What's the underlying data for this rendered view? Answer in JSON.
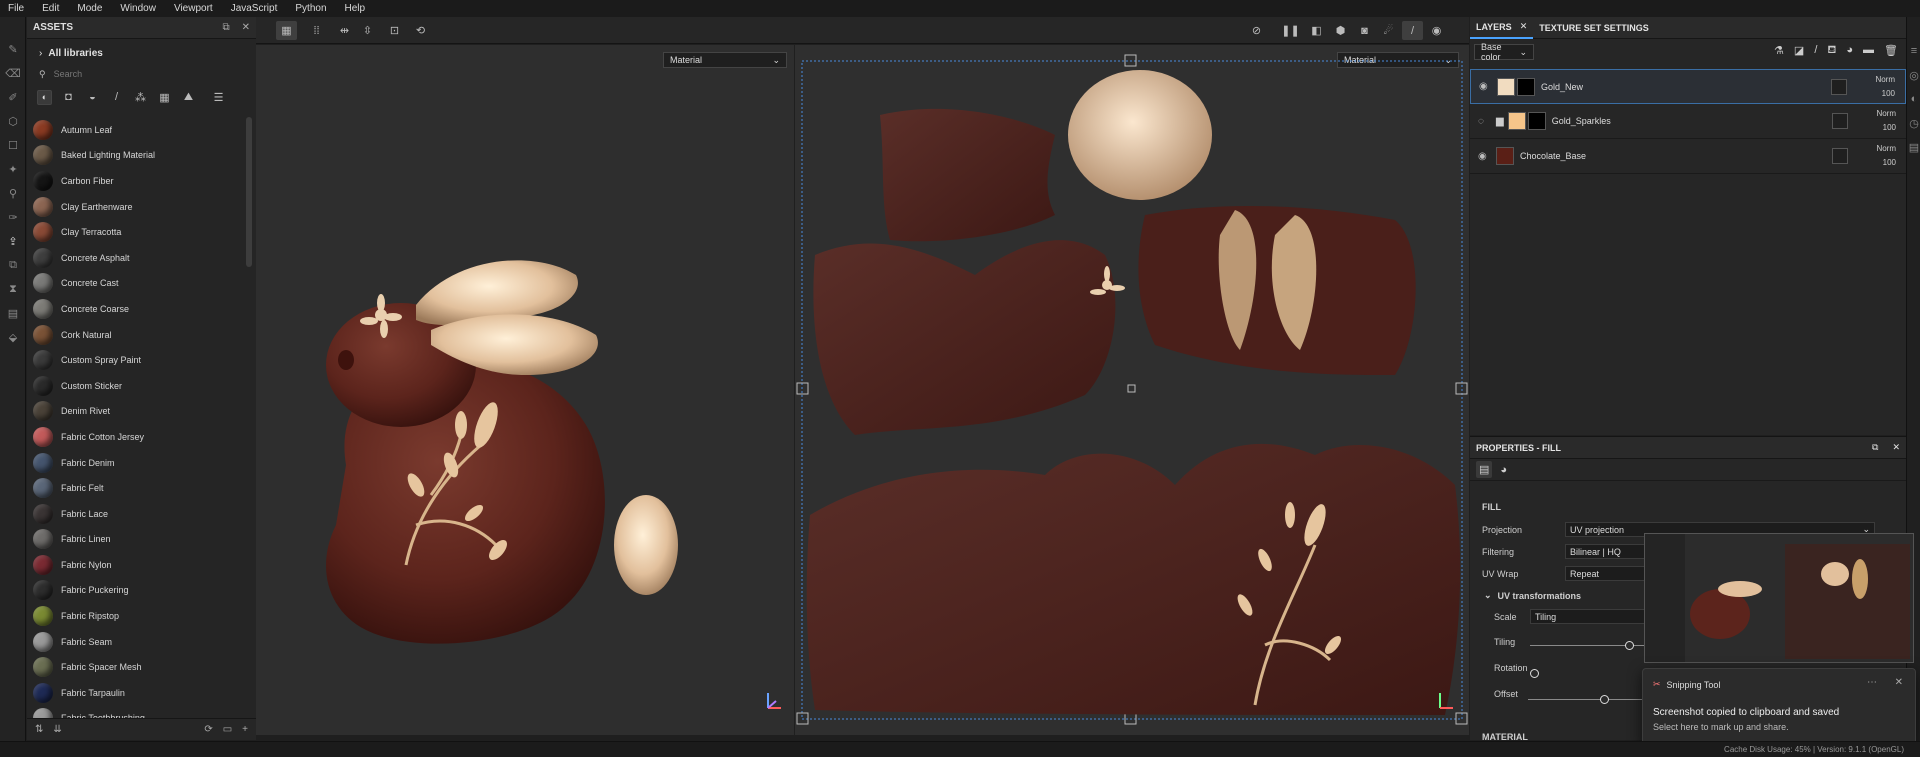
{
  "menu": [
    "File",
    "Edit",
    "Mode",
    "Window",
    "Viewport",
    "JavaScript",
    "Python",
    "Help"
  ],
  "assets": {
    "title": "ASSETS",
    "libraries": "All libraries",
    "search_placeholder": "Search",
    "materials": [
      {
        "name": "Autumn Leaf",
        "color": "#8a3a22"
      },
      {
        "name": "Baked Lighting Material",
        "color": "#6b5a48"
      },
      {
        "name": "Carbon Fiber",
        "color": "#151515"
      },
      {
        "name": "Clay Earthenware",
        "color": "#8c6552"
      },
      {
        "name": "Clay Terracotta",
        "color": "#8a4a36"
      },
      {
        "name": "Concrete Asphalt",
        "color": "#3e3e3e"
      },
      {
        "name": "Concrete Cast",
        "color": "#7a7a78"
      },
      {
        "name": "Concrete Coarse",
        "color": "#7c7b76"
      },
      {
        "name": "Cork Natural",
        "color": "#7a5236"
      },
      {
        "name": "Custom Spray Paint",
        "color": "#3a3a3a"
      },
      {
        "name": "Custom Sticker",
        "color": "#2a2a2a"
      },
      {
        "name": "Denim Rivet",
        "color": "#4a4238"
      },
      {
        "name": "Fabric Cotton Jersey",
        "color": "#c25a5a"
      },
      {
        "name": "Fabric Denim",
        "color": "#45556e"
      },
      {
        "name": "Fabric Felt",
        "color": "#5a6678"
      },
      {
        "name": "Fabric Lace",
        "color": "#3a3434"
      },
      {
        "name": "Fabric Linen",
        "color": "#6e6c6a"
      },
      {
        "name": "Fabric Nylon",
        "color": "#7a2a32"
      },
      {
        "name": "Fabric Puckering",
        "color": "#2d2d2d"
      },
      {
        "name": "Fabric Ripstop",
        "color": "#7a8a32"
      },
      {
        "name": "Fabric Seam",
        "color": "#9a9a9a"
      },
      {
        "name": "Fabric Spacer Mesh",
        "color": "#6a6e52"
      },
      {
        "name": "Fabric Tarpaulin",
        "color": "#1e2a55"
      },
      {
        "name": "Fabric Toothbrushing",
        "color": "#9a9a9a"
      }
    ]
  },
  "viewport": {
    "left_mode": "Material",
    "right_mode": "Material"
  },
  "layers": {
    "tabs": [
      "LAYERS",
      "TEXTURE SET SETTINGS"
    ],
    "channel": "Base color",
    "items": [
      {
        "name": "Gold_New",
        "blend": "Norm",
        "opacity": "100",
        "thumb": "#f1dcc0"
      },
      {
        "name": "Gold_Sparkles",
        "blend": "Norm",
        "opacity": "100",
        "thumb": "#f6c58a"
      },
      {
        "name": "Chocolate_Base",
        "blend": "Norm",
        "opacity": "100",
        "thumb": "#5a1f16"
      }
    ]
  },
  "properties": {
    "title": "PROPERTIES - FILL",
    "section": "FILL",
    "projection_label": "Projection",
    "projection_value": "UV projection",
    "filtering_label": "Filtering",
    "filtering_value": "Bilinear | HQ",
    "uvwrap_label": "UV Wrap",
    "uvwrap_value": "Repeat",
    "uvtrans_label": "UV transformations",
    "scale_label": "Scale",
    "scale_value": "Tiling",
    "tiling_label": "Tiling",
    "rotation_label": "Rotation",
    "offset_label": "Offset",
    "material_section": "MATERIAL"
  },
  "toast": {
    "app": "Snipping Tool",
    "title": "Screenshot copied to clipboard and saved",
    "body": "Select here to mark up and share."
  },
  "status": "Cache Disk Usage:   45%  |  Version: 9.1.1 (OpenGL)"
}
